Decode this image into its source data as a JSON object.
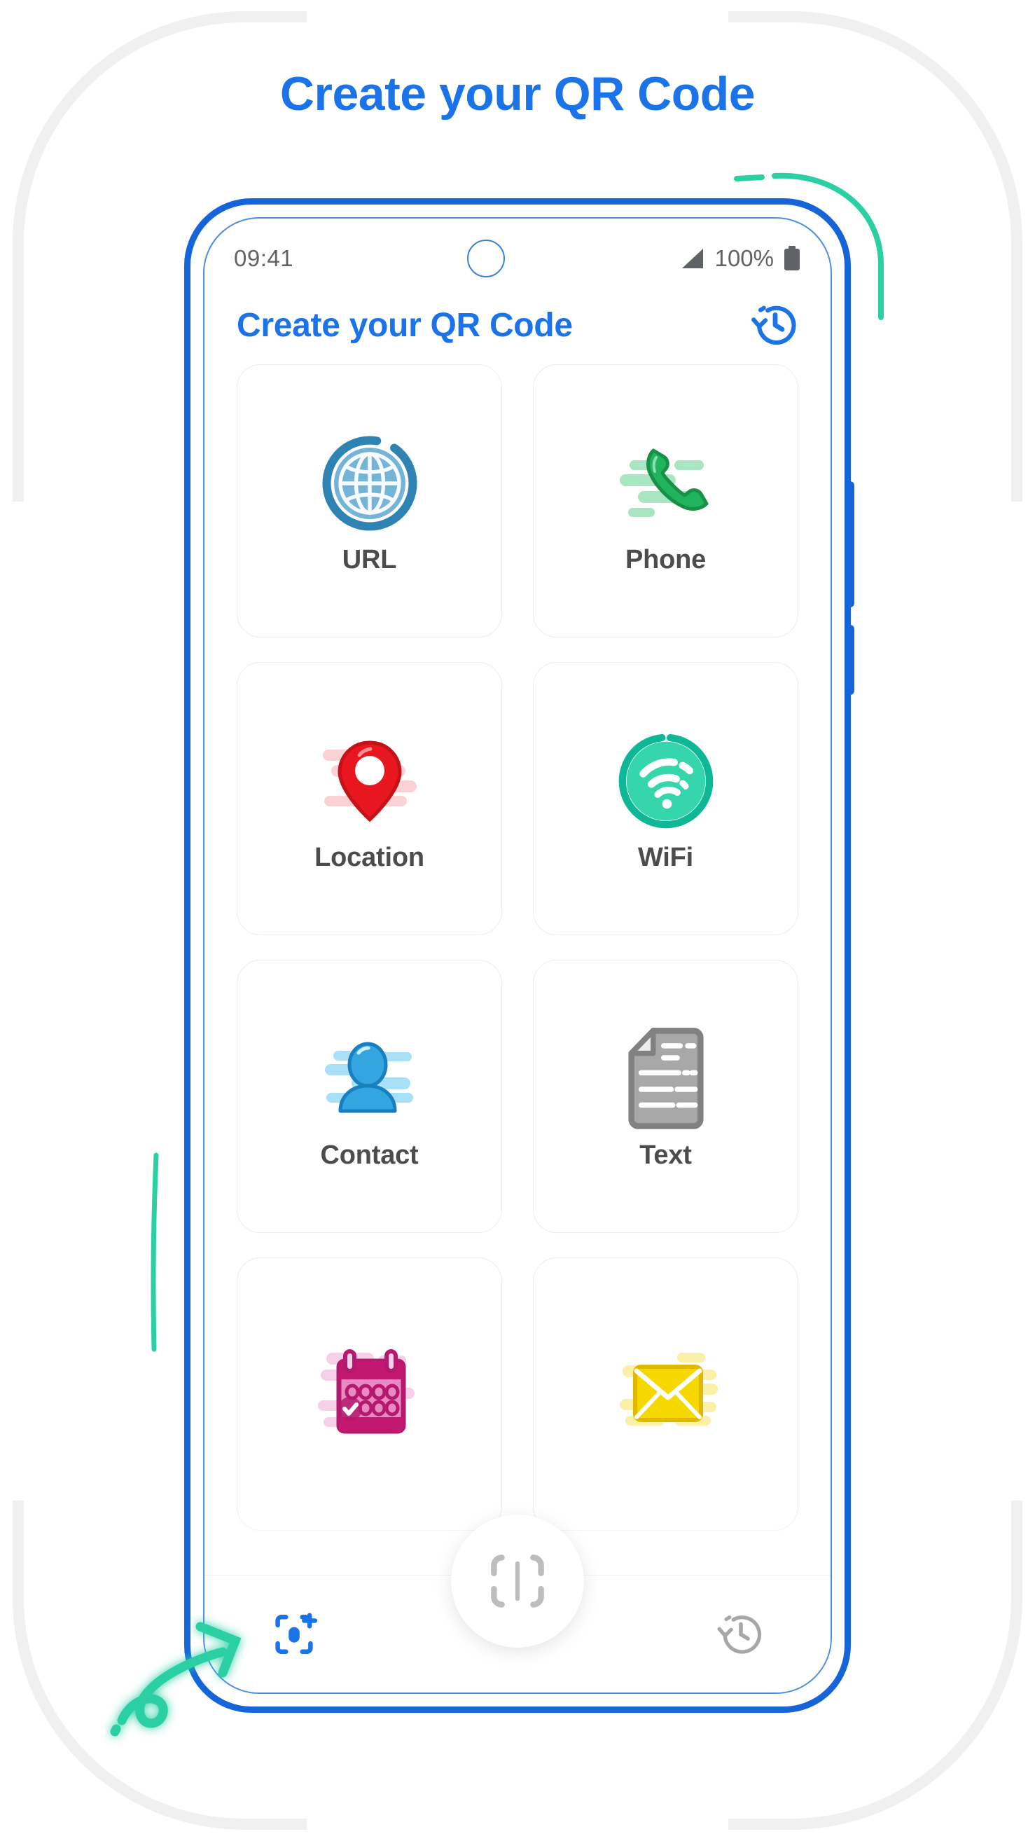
{
  "page": {
    "title": "Create your QR Code"
  },
  "phone": {
    "status_bar": {
      "time": "09:41",
      "battery_percent": "100%",
      "signal_icon": "signal-triangle-icon",
      "battery_icon": "battery-full-icon",
      "camera_icon": "front-camera-punchhole-icon"
    },
    "app_header": {
      "title": "Create your QR Code",
      "history_icon": "history-clock-icon"
    },
    "grid": {
      "items": [
        {
          "label": "URL",
          "icon": "globe-icon",
          "color": "#3b8fc4"
        },
        {
          "label": "Phone",
          "icon": "phone-icon",
          "color": "#1aa95a"
        },
        {
          "label": "Location",
          "icon": "map-pin-icon",
          "color": "#e8161f"
        },
        {
          "label": "WiFi",
          "icon": "wifi-icon",
          "color": "#2bcfa4"
        },
        {
          "label": "Contact",
          "icon": "person-icon",
          "color": "#2196dd"
        },
        {
          "label": "Text",
          "icon": "document-icon",
          "color": "#9a9a9a"
        },
        {
          "label": "",
          "icon": "calendar-icon",
          "color": "#c2186f"
        },
        {
          "label": "",
          "icon": "envelope-icon",
          "color": "#f5d800"
        }
      ]
    },
    "bottom_nav": {
      "create_icon": "qr-create-scan-icon",
      "scan_fab_icon": "scan-frame-icon",
      "history_icon": "history-clock-icon"
    }
  },
  "decorations": {
    "accent_blue": "#1a73e8",
    "accent_green": "#2bcfa4",
    "frame_gray": "#f0f0f0",
    "arrow_icon": "curly-arrow-icon",
    "arc_icon": "green-arc-decoration",
    "line_icon": "green-line-decoration"
  }
}
